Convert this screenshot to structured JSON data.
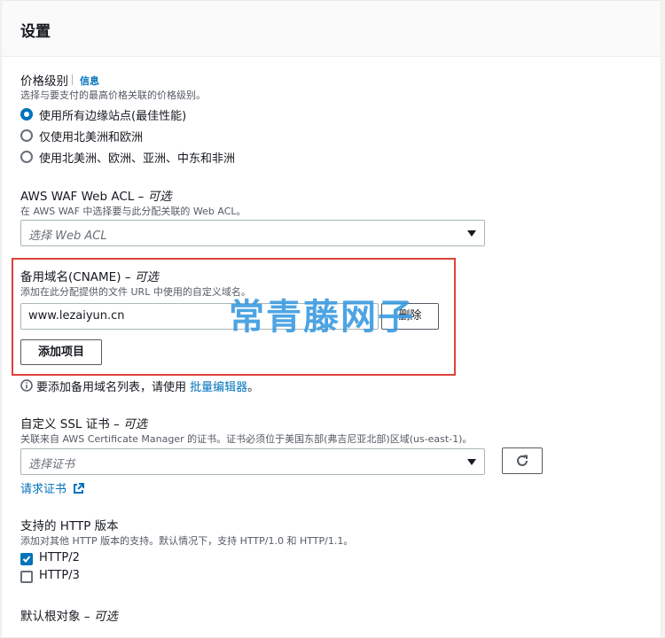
{
  "settings": {
    "title": "设置"
  },
  "price_class": {
    "label": "价格级别",
    "info": "信息",
    "description": "选择与要支付的最高价格关联的价格级别。",
    "options": [
      {
        "label": "使用所有边缘站点(最佳性能)",
        "selected": true
      },
      {
        "label": "仅使用北美洲和欧洲",
        "selected": false
      },
      {
        "label": "使用北美洲、欧洲、亚洲、中东和非洲",
        "selected": false
      }
    ]
  },
  "waf": {
    "label": "AWS WAF Web ACL",
    "optional": " – 可选",
    "description": "在 AWS WAF 中选择要与此分配关联的 Web ACL。",
    "placeholder": "选择 Web ACL"
  },
  "cname": {
    "label": "备用域名(CNAME)",
    "optional": " – 可选",
    "description": "添加在此分配提供的文件 URL 中使用的自定义域名。",
    "value": "www.lezaiyun.cn",
    "remove_label": "删除",
    "add_label": "添加项目",
    "bulk_hint": "要添加备用域名列表，请使用 ",
    "bulk_link": "批量编辑器",
    "bulk_end": "。"
  },
  "watermark": "常青藤网子",
  "ssl": {
    "label": "自定义 SSL 证书",
    "optional": " – 可选",
    "description": "关联来自 AWS Certificate Manager 的证书。证书必须位于美国东部(弗吉尼亚北部)区域(us-east-1)。",
    "placeholder": "选择证书",
    "request_link": "请求证书"
  },
  "http": {
    "label": "支持的 HTTP 版本",
    "description": "添加对其他 HTTP 版本的支持。默认情况下，支持 HTTP/1.0 和 HTTP/1.1。",
    "options": [
      {
        "label": "HTTP/2",
        "checked": true
      },
      {
        "label": "HTTP/3",
        "checked": false
      }
    ]
  },
  "default_root": {
    "label": "默认根对象",
    "optional": " – 可选"
  }
}
